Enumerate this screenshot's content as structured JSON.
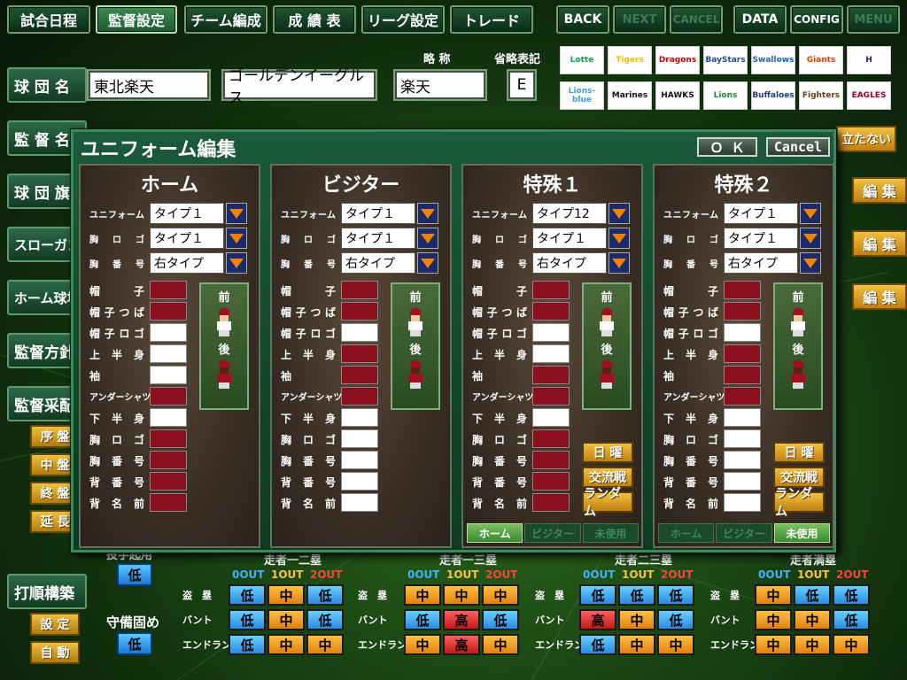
{
  "nav": {
    "schedule": "試合日程",
    "manager_settings": "監督設定",
    "team_building": "チーム編成",
    "stats": "成 績 表",
    "league_settings": "リーグ設定",
    "trade": "トレード",
    "back": "BACK",
    "next": "NEXT",
    "cancel": "CANCEL",
    "data": "DATA",
    "config": "CONFIG",
    "menu": "MENU"
  },
  "team": {
    "row_label": "球 団 名",
    "name": "東北楽天",
    "nickname": "ゴールデンイーグルス",
    "short_label": "略 称",
    "short": "楽天",
    "abbr_label": "省略表記",
    "abbr": "E"
  },
  "team_logos": [
    {
      "name": "Lotte",
      "color": "#0aa04a"
    },
    {
      "name": "Tigers",
      "color": "#f0c000"
    },
    {
      "name": "Dragons",
      "color": "#d00000"
    },
    {
      "name": "BayStars",
      "color": "#1a4aa0"
    },
    {
      "name": "Swallows",
      "color": "#1a60c0"
    },
    {
      "name": "Giants",
      "color": "#e04000"
    },
    {
      "name": "H",
      "color": "#2a1a6a"
    },
    {
      "name": "Lions-blue",
      "color": "#3aa0e0"
    },
    {
      "name": "Marines",
      "color": "#111111"
    },
    {
      "name": "HAWKS",
      "color": "#111111"
    },
    {
      "name": "Lions",
      "color": "#1a8a3a"
    },
    {
      "name": "Buffaloes",
      "color": "#1a3a8a"
    },
    {
      "name": "Fighters",
      "color": "#6a3a1a"
    },
    {
      "name": "EAGLES",
      "color": "#a00020"
    }
  ],
  "left_labels": {
    "manager": "監 督 名",
    "flag": "球 団 旗",
    "slogan": "スローガン",
    "home_stadium": "ホーム球場",
    "policy": "監督方針",
    "tactics": "監督采配",
    "early": "序 盤",
    "middle": "中 盤",
    "late": "終 盤",
    "extra": "延 長",
    "batting_order": "打順構築",
    "setup": "設 定",
    "auto": "自 動"
  },
  "right_buttons": {
    "standout": "立たない",
    "edit": "編 集"
  },
  "dialog": {
    "title": "ユニフォーム編集",
    "ok": "Ｏ Ｋ",
    "cancel": "Cancel",
    "row_labels": {
      "uniform": "ユニフォーム",
      "chest_logo": "胸ロゴ",
      "chest_number": "胸番号",
      "cap": "帽子",
      "cap_brim": "帽子つば",
      "cap_logo": "帽子ロゴ",
      "upper_body": "上半身",
      "sleeve": "袖",
      "undershirt": "アンダーシャツ",
      "lower_body": "下半身",
      "chest_logo2": "胸ロゴ",
      "chest_number2": "胸番号",
      "back_number": "背番号",
      "back_name": "背名前"
    },
    "front": "前",
    "back": "後",
    "day_buttons": [
      "日 曜",
      "交流戦",
      "ランダム"
    ],
    "tab_labels": [
      "ホーム",
      "ビジター",
      "未使用"
    ],
    "panels": [
      {
        "title": "ホーム",
        "uniform": "タイプ１",
        "chest_logo": "タイプ１",
        "chest_number": "右タイプ",
        "colors": [
          "red",
          "red",
          "white",
          "white",
          "white",
          "red",
          "white",
          "red",
          "red",
          "red",
          "red"
        ]
      },
      {
        "title": "ビジター",
        "uniform": "タイプ１",
        "chest_logo": "タイプ１",
        "chest_number": "右タイプ",
        "colors": [
          "red",
          "red",
          "white",
          "red",
          "red",
          "red",
          "white",
          "white",
          "white",
          "white",
          "white"
        ]
      },
      {
        "title": "特殊１",
        "uniform": "タイプ12",
        "chest_logo": "タイプ１",
        "chest_number": "右タイプ",
        "colors": [
          "red",
          "red",
          "white",
          "white",
          "red",
          "red",
          "white",
          "red",
          "red",
          "red",
          "red"
        ],
        "active_tab": 0
      },
      {
        "title": "特殊２",
        "uniform": "タイプ１",
        "chest_logo": "タイプ１",
        "chest_number": "右タイプ",
        "colors": [
          "red",
          "red",
          "white",
          "red",
          "red",
          "red",
          "white",
          "white",
          "white",
          "white",
          "white"
        ],
        "active_tab": 2
      }
    ]
  },
  "strategy": {
    "pinch_label": "投手起用",
    "pinch_value": "低",
    "defense_label": "守備固め",
    "defense_value": "低",
    "row_names": [
      "盗　塁",
      "バント",
      "エンドラン"
    ],
    "out_labels": [
      "0OUT",
      "1OUT",
      "2OUT"
    ],
    "sections": [
      {
        "title": "走者一二塁",
        "rows": [
          [
            "低",
            "中",
            "低"
          ],
          [
            "低",
            "中",
            "低"
          ],
          [
            "低",
            "中",
            "中"
          ]
        ]
      },
      {
        "title": "走者一三塁",
        "rows": [
          [
            "中",
            "中",
            "中"
          ],
          [
            "低",
            "高",
            "低"
          ],
          [
            "中",
            "高",
            "中"
          ]
        ]
      },
      {
        "title": "走者二三塁",
        "rows": [
          [
            "低",
            "低",
            "低"
          ],
          [
            "高",
            "中",
            "低"
          ],
          [
            "低",
            "中",
            "中"
          ]
        ]
      },
      {
        "title": "走者満塁",
        "rows": [
          [
            "中",
            "低",
            "低"
          ],
          [
            "中",
            "中",
            "低"
          ],
          [
            "中",
            "中",
            "中"
          ]
        ]
      }
    ]
  }
}
